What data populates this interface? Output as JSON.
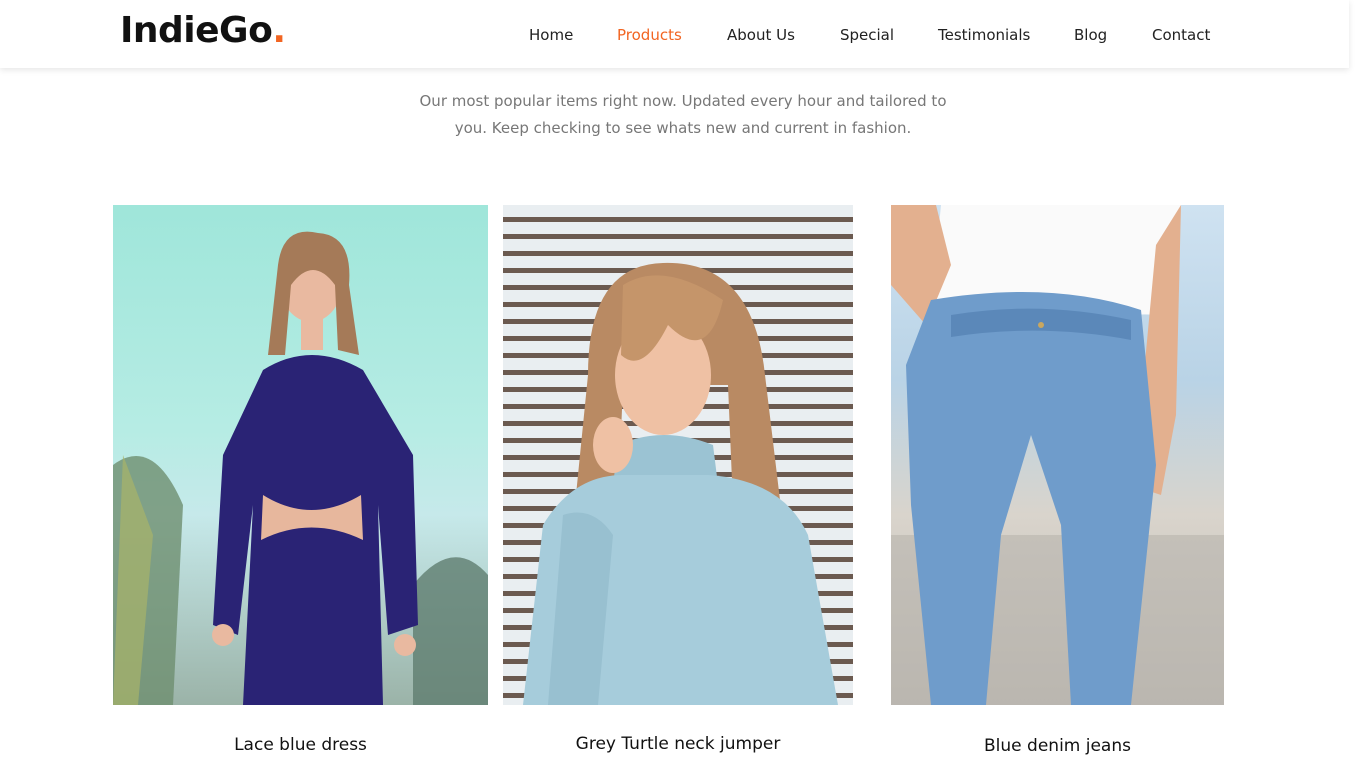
{
  "header": {
    "logo_text": "IndieGo",
    "logo_dot": ".",
    "nav": [
      "Home",
      "Products",
      "About Us",
      "Special",
      "Testimonials",
      "Blog",
      "Contact"
    ],
    "active_nav": "Products",
    "accent_color": "#f26522"
  },
  "intro": {
    "line1": "Our most popular items right now. Updated every hour and tailored to",
    "line2": "you. Keep checking to see whats new and current in fashion."
  },
  "products": [
    {
      "title": "Lace blue dress"
    },
    {
      "title": "Grey Turtle neck jumper"
    },
    {
      "title": "Blue denim jeans"
    }
  ]
}
